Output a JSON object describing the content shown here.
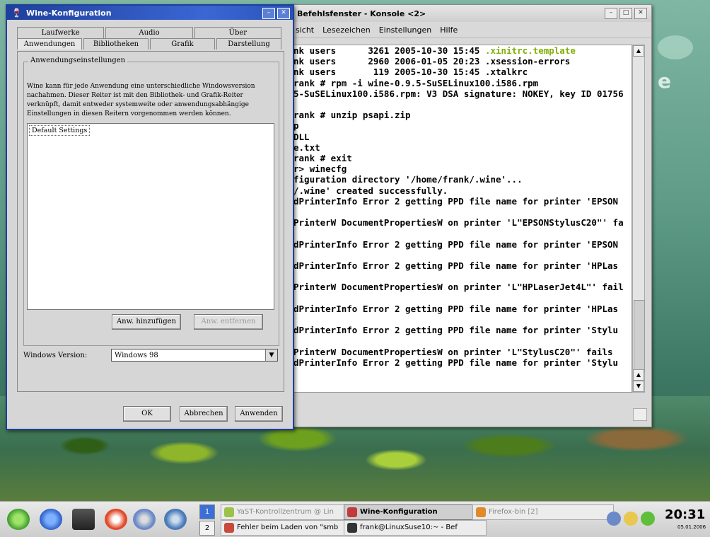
{
  "colors": {
    "wine_title": "#1e3f9c",
    "terminal_highlight": "#7fb000"
  },
  "desktop": {
    "brand": "e"
  },
  "console": {
    "title": "Befehlsfenster - Konsole <2>",
    "menu": [
      "sicht",
      "Lesezeichen",
      "Einstellungen",
      "Hilfe"
    ],
    "lines": [
      {
        "pre": "nk users      3261 2005-10-30 15:45 ",
        "hl": ".xinitrc.template"
      },
      {
        "pre": "nk users      2960 2006-01-05 20:23 .xsession-errors",
        "hl": ""
      },
      {
        "pre": "nk users       119 2005-10-30 15:45 .xtalkrc",
        "hl": ""
      },
      {
        "pre": "rank # rpm -i wine-0.9.5-SuSELinux100.i586.rpm",
        "hl": ""
      },
      {
        "pre": "5-SuSELinux100.i586.rpm: V3 DSA signature: NOKEY, key ID 01756",
        "hl": ""
      },
      {
        "pre": "",
        "hl": ""
      },
      {
        "pre": "rank # unzip psapi.zip",
        "hl": ""
      },
      {
        "pre": "p",
        "hl": ""
      },
      {
        "pre": "DLL",
        "hl": ""
      },
      {
        "pre": "e.txt",
        "hl": ""
      },
      {
        "pre": "rank # exit",
        "hl": ""
      },
      {
        "pre": "r> winecfg",
        "hl": ""
      },
      {
        "pre": "figuration directory '/home/frank/.wine'...",
        "hl": ""
      },
      {
        "pre": "/.wine' created successfully.",
        "hl": ""
      },
      {
        "pre": "dPrinterInfo Error 2 getting PPD file name for printer 'EPSON",
        "hl": ""
      },
      {
        "pre": "",
        "hl": ""
      },
      {
        "pre": "PrinterW DocumentPropertiesW on printer 'L\"EPSONStylusC20\"' fa",
        "hl": ""
      },
      {
        "pre": "",
        "hl": ""
      },
      {
        "pre": "dPrinterInfo Error 2 getting PPD file name for printer 'EPSON",
        "hl": ""
      },
      {
        "pre": "",
        "hl": ""
      },
      {
        "pre": "dPrinterInfo Error 2 getting PPD file name for printer 'HPLas",
        "hl": ""
      },
      {
        "pre": "",
        "hl": ""
      },
      {
        "pre": "PrinterW DocumentPropertiesW on printer 'L\"HPLaserJet4L\"' fail",
        "hl": ""
      },
      {
        "pre": "",
        "hl": ""
      },
      {
        "pre": "dPrinterInfo Error 2 getting PPD file name for printer 'HPLas",
        "hl": ""
      },
      {
        "pre": "",
        "hl": ""
      },
      {
        "pre": "dPrinterInfo Error 2 getting PPD file name for printer 'Stylu",
        "hl": ""
      },
      {
        "pre": "",
        "hl": ""
      },
      {
        "pre": "PrinterW DocumentPropertiesW on printer 'L\"StylusC20\"' fails",
        "hl": ""
      },
      {
        "pre": "dPrinterInfo Error 2 getting PPD file name for printer 'Stylu",
        "hl": ""
      }
    ]
  },
  "wine": {
    "title": "Wine-Konfiguration",
    "tabs_row1": [
      "Laufwerke",
      "Audio",
      "Über"
    ],
    "tabs_row2": [
      "Anwendungen",
      "Bibliotheken",
      "Grafik",
      "Darstellung"
    ],
    "group_label": "Anwendungseinstellungen",
    "description": "Wine kann für jede Anwendung eine unterschiedliche Windowsversion nachahmen. Dieser Reiter ist mit den Bibliothek- und Grafik-Reiter verknüpft, damit entweder systemweite oder anwendungsabhängige Einstellungen in diesen Reitern vorgenommen werden können.",
    "list_items": [
      "Default Settings"
    ],
    "add_button": "Anw. hinzufügen",
    "remove_button": "Anw. entfernen",
    "winver_label": "Windows Version:",
    "winver_value": "Windows 98",
    "ok": "OK",
    "cancel": "Abbrechen",
    "apply": "Anwenden"
  },
  "taskbar": {
    "pager": [
      "1",
      "2"
    ],
    "tasks": [
      {
        "label": "YaST-Kontrollzentrum @ Lin",
        "state": "dim"
      },
      {
        "label": "Wine-Konfiguration",
        "state": "active"
      },
      {
        "label": "Firefox-bin [2]",
        "state": "dim"
      },
      {
        "label": "Fehler beim Laden von \"smb",
        "state": "normal"
      },
      {
        "label": "frank@LinuxSuse10:~ - Bef",
        "state": "normal"
      }
    ],
    "clock": "20:31",
    "date": "05.01.2006"
  }
}
